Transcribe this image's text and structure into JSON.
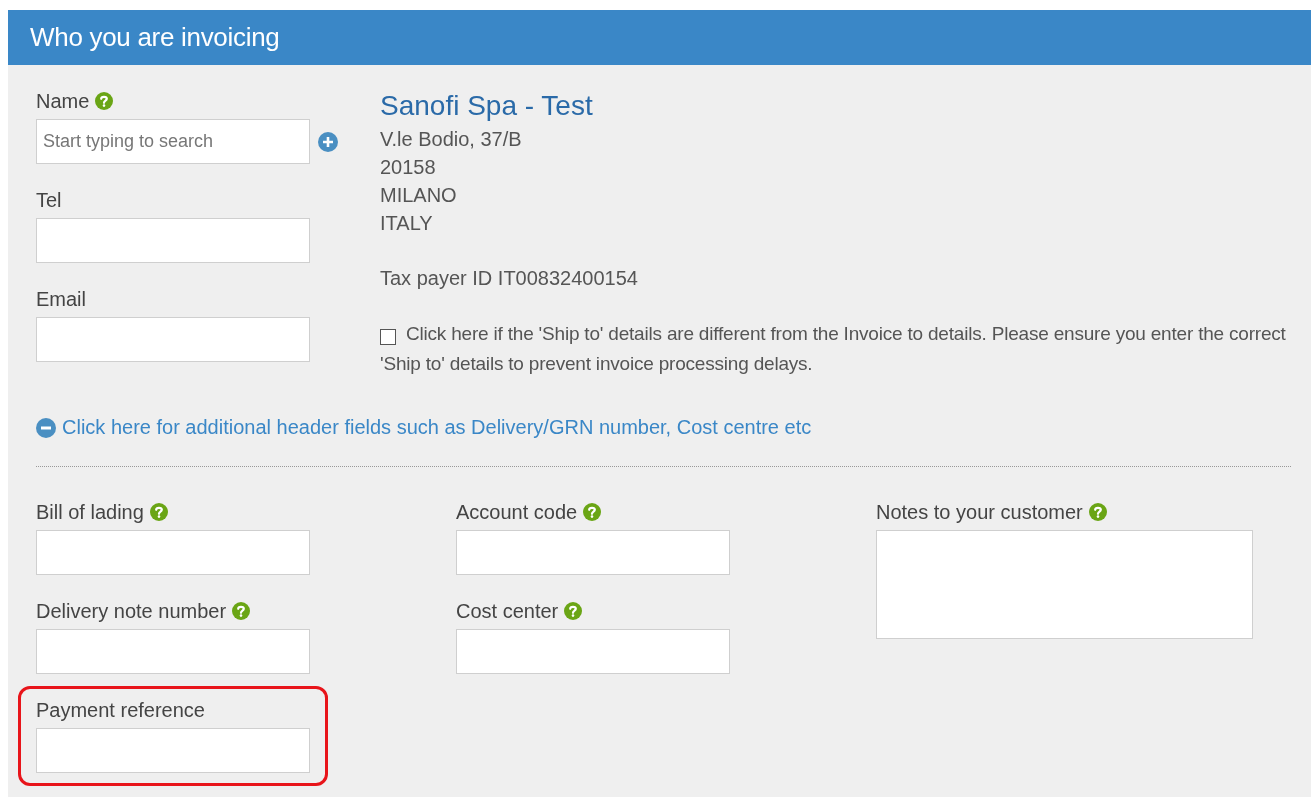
{
  "header": {
    "title": "Who you are invoicing"
  },
  "contact_fields": [
    {
      "label": "Name",
      "help": true,
      "placeholder": "Start typing to search",
      "add": true
    },
    {
      "label": "Tel",
      "help": false,
      "add": false
    },
    {
      "label": "Email",
      "help": false,
      "add": false
    }
  ],
  "customer": {
    "name": "Sanofi Spa - Test",
    "address_lines": [
      "V.le Bodio, 37/B",
      "20158",
      "MILANO",
      "ITALY"
    ],
    "tax_id": "Tax payer ID IT00832400154"
  },
  "ship_to": {
    "checked": false,
    "label": "Click here if the 'Ship to' details are different from the Invoice to details. Please ensure you enter the correct 'Ship to' details to prevent invoice processing delays."
  },
  "additional_toggle": {
    "expanded": true,
    "label": "Click here for additional header fields such as Delivery/GRN number, Cost centre etc"
  },
  "field_columns": [
    {
      "fields": [
        {
          "label": "Bill of lading",
          "help": true,
          "kind": "input",
          "highlighted": false
        },
        {
          "label": "Delivery note number",
          "help": true,
          "kind": "input",
          "highlighted": false
        },
        {
          "label": "Payment reference",
          "help": false,
          "kind": "input",
          "highlighted": true
        }
      ]
    },
    {
      "fields": [
        {
          "label": "Account code",
          "help": true,
          "kind": "input",
          "highlighted": false
        },
        {
          "label": "Cost center",
          "help": true,
          "kind": "input",
          "highlighted": false
        }
      ]
    },
    {
      "fields": [
        {
          "label": "Notes to your customer",
          "help": true,
          "kind": "textarea",
          "highlighted": false
        }
      ]
    }
  ]
}
